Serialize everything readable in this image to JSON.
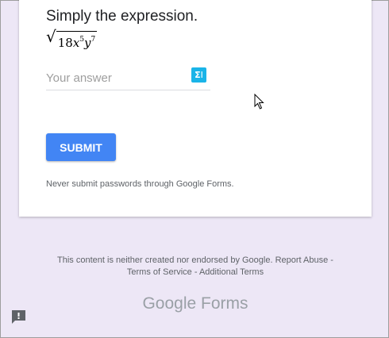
{
  "question": {
    "title": "Simply the expression.",
    "expression": {
      "coefficient": "18",
      "var1": "x",
      "exp1": "5",
      "var2": "y",
      "exp2": "7"
    }
  },
  "answer": {
    "placeholder": "Your answer",
    "value": ""
  },
  "equation_button": {
    "icon": "sigma-cursor-icon",
    "label": "Σ"
  },
  "submit": {
    "label": "SUBMIT"
  },
  "warning": "Never submit passwords through Google Forms.",
  "footer": {
    "line1": "This content is neither created nor endorsed by Google. Report Abuse -",
    "line2": "Terms of Service - Additional Terms",
    "brand_google": "Google",
    "brand_forms": "Forms"
  },
  "colors": {
    "accent": "#4285f4",
    "background": "#ede7f6",
    "equation_button": "#1ab4e8"
  }
}
